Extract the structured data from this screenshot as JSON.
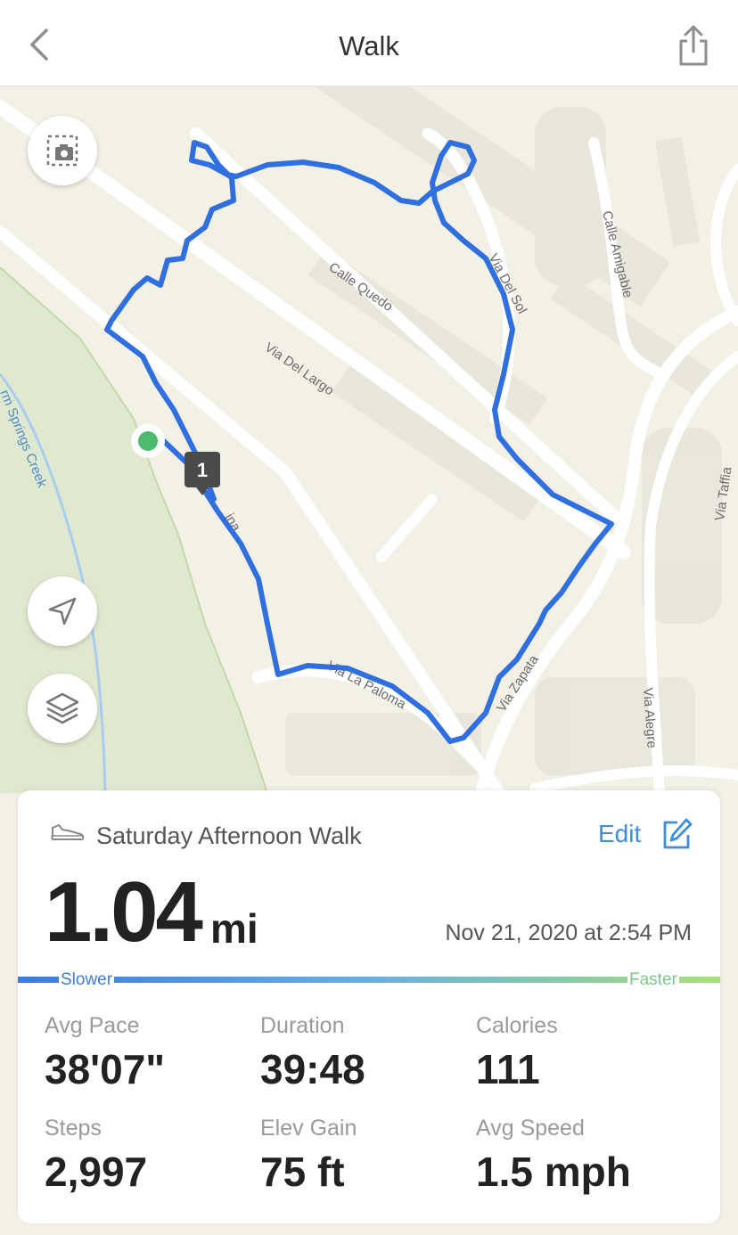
{
  "header": {
    "title": "Walk",
    "back_icon": "chevron-left-icon",
    "share_icon": "share-icon"
  },
  "map": {
    "streets": [
      "Calle Quedo",
      "Via Del Sol",
      "Calle Amigable",
      "Via Del Largo",
      "Via Taffia",
      "Via Zapata",
      "Via Alegre",
      "Via La Paloma",
      "rm Springs Creek",
      "ina"
    ],
    "start_marker_color": "#4cbb6c",
    "route_color": "#2f6fe0",
    "mile_marker": "1",
    "buttons": {
      "snapshot_icon": "camera-snapshot-icon",
      "locate_icon": "location-arrow-icon",
      "layers_icon": "layers-icon"
    }
  },
  "card": {
    "activity_icon": "shoe-icon",
    "walk_name": "Saturday Afternoon Walk",
    "edit_label": "Edit",
    "distance": "1.04",
    "distance_unit": "mi",
    "date": "Nov 21, 2020 at 2:54 PM",
    "speed_legend": {
      "slower": "Slower",
      "faster": "Faster"
    },
    "stats": [
      {
        "label": "Avg Pace",
        "value": "38'07\""
      },
      {
        "label": "Duration",
        "value": "39:48"
      },
      {
        "label": "Calories",
        "value": "111"
      },
      {
        "label": "Steps",
        "value": "2,997"
      },
      {
        "label": "Elev Gain",
        "value": "75 ft"
      },
      {
        "label": "Avg Speed",
        "value": "1.5 mph"
      }
    ]
  },
  "colors": {
    "accent": "#3d8ee0",
    "slower": "#3d7be0",
    "faster": "#a6e07a"
  }
}
